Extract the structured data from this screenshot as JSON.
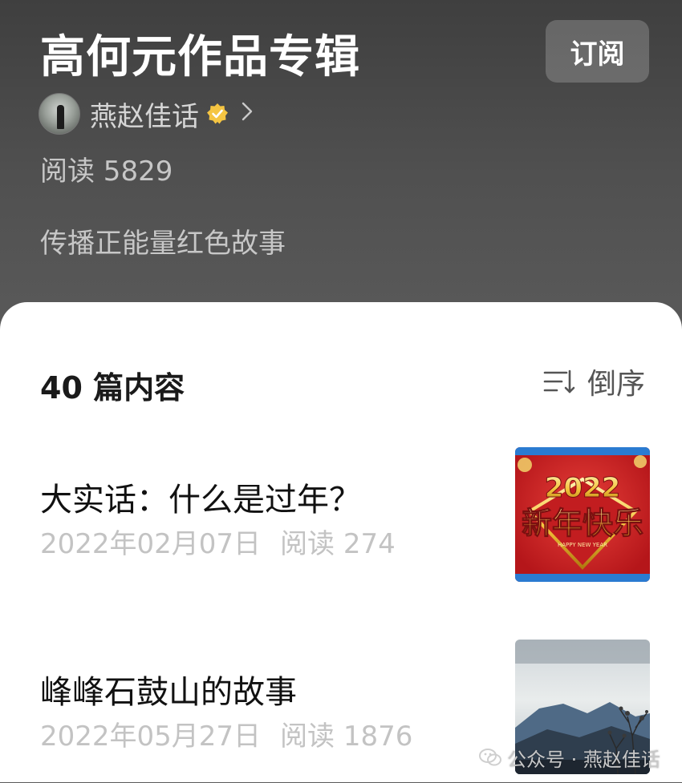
{
  "header": {
    "album_title": "高何元作品专辑",
    "subscribe_label": "订阅",
    "author_name": "燕赵佳话",
    "read_count": "阅读 5829",
    "description": "传播正能量红色故事"
  },
  "content": {
    "count_label": "40 篇内容",
    "sort_label": "倒序"
  },
  "articles": [
    {
      "title": "大实话：什么是过年？",
      "date": "2022年02月07日",
      "reads": "阅读 274",
      "thumb_year": "2022",
      "thumb_text": "新年快乐",
      "thumb_subtext": "HAPPY NEW YEAR"
    },
    {
      "title": "峰峰石鼓山的故事",
      "date": "2022年05月27日",
      "reads": "阅读 1876"
    }
  ],
  "watermark": {
    "text": "公众号 · 燕赵佳话"
  },
  "icons": {
    "verified": "verified-badge-icon",
    "chevron": "chevron-right-icon",
    "sort": "sort-descending-icon",
    "wechat": "wechat-icon"
  },
  "colors": {
    "header_bg": "#505050",
    "badge": "#f5c542",
    "meta_text": "#c3c3c3"
  }
}
